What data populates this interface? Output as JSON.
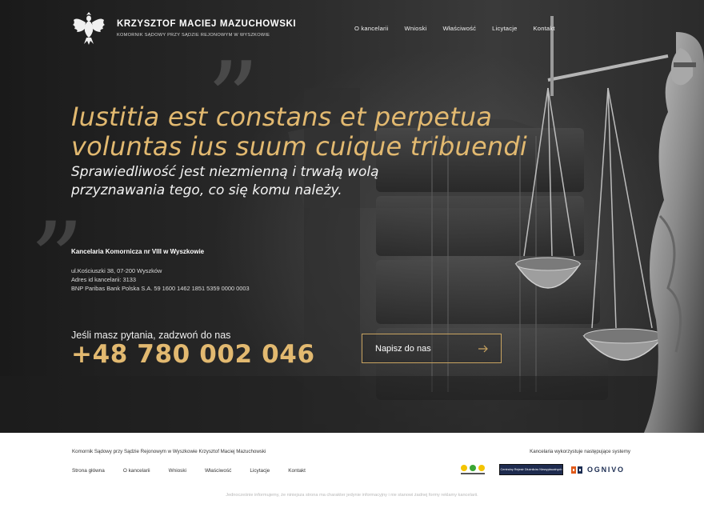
{
  "header": {
    "logo_icon": "eagle-emblem-icon",
    "name": "KRZYSZTOF MACIEJ MAZUCHOWSKI",
    "subtitle": "KOMORNIK SĄDOWY PRZY SĄDZIE REJONOWYM W WYSZKOWIE",
    "nav": [
      "O kancelarii",
      "Wnioski",
      "Właściwość",
      "Licytacje",
      "Kontakt"
    ]
  },
  "hero": {
    "latin_line1": "Iustitia est constans et perpetua",
    "latin_line2": "voluntas ius suum cuique tribuendi",
    "polish_line1": "Sprawiedliwość jest niezmienną i trwałą wolą",
    "polish_line2": "przyznawania tego, co się komu należy.",
    "office_name": "Kancelaria Komornicza nr VIII w Wyszkowie",
    "address": "ul.Kościuszki 38, 07-200 Wyszków",
    "office_id": "Adres id kancelarii: 3133",
    "bank": "BNP Paribas Bank Polska S.A. 59 1600 1462 1851 5359 0000 0003",
    "call_label": "Jeśli masz pytania, zadzwoń do nas",
    "phone": "+48 780 002 046",
    "cta_label": "Napisz do nas",
    "cta_icon": "arrow-right-icon",
    "accent_color": "#e2b970"
  },
  "footer": {
    "left_text": "Komornik Sądowy przy Sądzie Rejonowym w Wyszkowie Krzysztof Maciej Mazuchowski",
    "right_text": "Kancelaria wykorzystuje następujące systemy",
    "nav": [
      "Strona główna",
      "O kancelarii",
      "Wnioski",
      "Właściwość",
      "Licytacje",
      "Kontakt"
    ],
    "partner_crb": "Centralny Rejestr Dłużników Niewypłacalnych",
    "partner_ognivo": "OGNIVO",
    "note": "Jednocześnie informujemy, że niniejsza strona ma charakter jedynie informacyjny i nie stanowi żadnej formy reklamy kancelarii."
  }
}
